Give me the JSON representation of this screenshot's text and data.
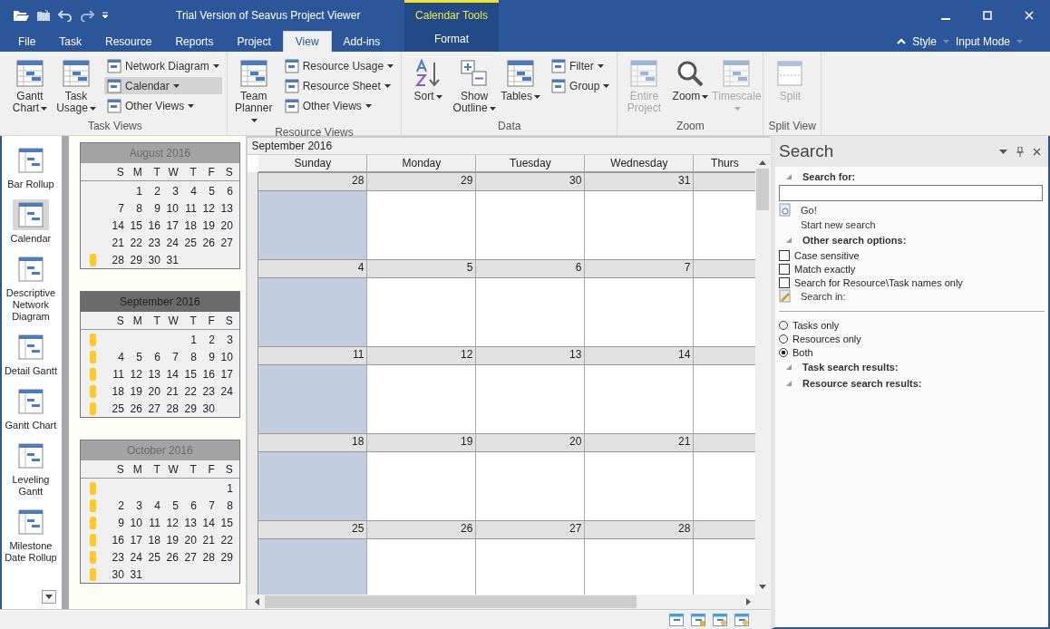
{
  "window": {
    "title": "Trial Version of Seavus Project Viewer"
  },
  "tabs": [
    {
      "label": "File",
      "selected": false
    },
    {
      "label": "Task",
      "selected": false
    },
    {
      "label": "Resource",
      "selected": false
    },
    {
      "label": "Reports",
      "selected": false
    },
    {
      "label": "Project",
      "selected": false
    },
    {
      "label": "View",
      "selected": true
    },
    {
      "label": "Add-ins",
      "selected": false
    }
  ],
  "contextual": {
    "title": "Calendar Tools",
    "tabs": [
      {
        "label": "Format",
        "selected": false
      }
    ]
  },
  "ribbon_options": [
    "Style",
    "Input Mode"
  ],
  "ribbon": {
    "groups": [
      {
        "label": "Task Views",
        "columns": [
          {
            "kind": "large",
            "label": "Gantt Chart",
            "dropdown": true,
            "disabled": false
          },
          {
            "kind": "large",
            "label": "Task Usage",
            "dropdown": true,
            "disabled": false
          },
          {
            "kind": "stack",
            "items": [
              {
                "label": "Network Diagram",
                "dropdown": true,
                "selected": false
              },
              {
                "label": "Calendar",
                "dropdown": true,
                "selected": true
              },
              {
                "label": "Other Views",
                "dropdown": true,
                "selected": false
              }
            ]
          }
        ]
      },
      {
        "label": "Resource Views",
        "columns": [
          {
            "kind": "large",
            "label": "Team Planner",
            "dropdown": true,
            "disabled": false
          },
          {
            "kind": "stack",
            "items": [
              {
                "label": "Resource Usage",
                "dropdown": true,
                "selected": false
              },
              {
                "label": "Resource Sheet",
                "dropdown": true,
                "selected": false
              },
              {
                "label": "Other Views",
                "dropdown": true,
                "selected": false
              }
            ]
          }
        ]
      },
      {
        "label": "Data",
        "columns": [
          {
            "kind": "large",
            "label": "Sort",
            "dropdown": true,
            "disabled": false
          },
          {
            "kind": "large",
            "label": "Show Outline",
            "dropdown": true,
            "disabled": false
          },
          {
            "kind": "large",
            "label": "Tables",
            "dropdown": true,
            "disabled": false
          },
          {
            "kind": "stack",
            "items": [
              {
                "label": "Filter",
                "dropdown": true,
                "selected": false
              },
              {
                "label": "Group",
                "dropdown": true,
                "selected": false
              }
            ]
          }
        ]
      },
      {
        "label": "Zoom",
        "columns": [
          {
            "kind": "large",
            "label": "Entire Project",
            "dropdown": false,
            "disabled": true
          },
          {
            "kind": "large",
            "label": "Zoom",
            "dropdown": true,
            "disabled": false
          },
          {
            "kind": "large",
            "label": "Timescale",
            "dropdown": true,
            "disabled": true
          }
        ]
      },
      {
        "label": "Split View",
        "columns": [
          {
            "kind": "large",
            "label": "Split",
            "dropdown": false,
            "disabled": true
          }
        ]
      }
    ]
  },
  "view_bar": [
    {
      "label": "Bar Rollup",
      "selected": false
    },
    {
      "label": "Calendar",
      "selected": true
    },
    {
      "label": "Descriptive Network Diagram",
      "selected": false
    },
    {
      "label": "Detail Gantt",
      "selected": false
    },
    {
      "label": "Gantt Chart",
      "selected": false
    },
    {
      "label": "Leveling Gantt",
      "selected": false
    },
    {
      "label": "Milestone Date Rollup",
      "selected": false
    }
  ],
  "mini_calendars": [
    {
      "title": "August 2016",
      "selected": false,
      "weekdays": [
        "S",
        "M",
        "T",
        "W",
        "T",
        "F",
        "S"
      ],
      "weeks": [
        {
          "marked": false,
          "days": [
            "1",
            "2",
            "3",
            "4",
            "5",
            "6"
          ]
        },
        {
          "marked": false,
          "days": [
            "7",
            "8",
            "9",
            "10",
            "11",
            "12",
            "13"
          ]
        },
        {
          "marked": false,
          "days": [
            "14",
            "15",
            "16",
            "17",
            "18",
            "19",
            "20"
          ]
        },
        {
          "marked": false,
          "days": [
            "21",
            "22",
            "23",
            "24",
            "25",
            "26",
            "27"
          ]
        },
        {
          "marked": true,
          "days": [
            "28",
            "29",
            "30",
            "31"
          ]
        }
      ]
    },
    {
      "title": "September 2016",
      "selected": true,
      "weekdays": [
        "S",
        "M",
        "T",
        "W",
        "T",
        "F",
        "S"
      ],
      "weeks": [
        {
          "marked": true,
          "days": [
            "1",
            "2",
            "3"
          ]
        },
        {
          "marked": true,
          "days": [
            "4",
            "5",
            "6",
            "7",
            "8",
            "9",
            "10"
          ]
        },
        {
          "marked": true,
          "days": [
            "11",
            "12",
            "13",
            "14",
            "15",
            "16",
            "17"
          ]
        },
        {
          "marked": true,
          "days": [
            "18",
            "19",
            "20",
            "21",
            "22",
            "23",
            "24"
          ]
        },
        {
          "marked": true,
          "days": [
            "25",
            "26",
            "27",
            "28",
            "29",
            "30"
          ]
        }
      ]
    },
    {
      "title": "October 2016",
      "selected": false,
      "weekdays": [
        "S",
        "M",
        "T",
        "W",
        "T",
        "F",
        "S"
      ],
      "weeks": [
        {
          "marked": true,
          "days": [
            "1"
          ]
        },
        {
          "marked": true,
          "days": [
            "2",
            "3",
            "4",
            "5",
            "6",
            "7",
            "8"
          ]
        },
        {
          "marked": true,
          "days": [
            "9",
            "10",
            "11",
            "12",
            "13",
            "14",
            "15"
          ]
        },
        {
          "marked": true,
          "days": [
            "16",
            "17",
            "18",
            "19",
            "20",
            "21",
            "22"
          ]
        },
        {
          "marked": true,
          "days": [
            "23",
            "24",
            "25",
            "26",
            "27",
            "28",
            "29"
          ]
        },
        {
          "marked": true,
          "days": [
            "30",
            "31"
          ]
        }
      ]
    }
  ],
  "calendar": {
    "title": "September 2016",
    "weekdays": [
      "Sunday",
      "Monday",
      "Tuesday",
      "Wednesday",
      "Thurs"
    ],
    "weeks": [
      {
        "days": [
          {
            "date": "28",
            "shaded": true
          },
          {
            "date": "29",
            "shaded": false
          },
          {
            "date": "30",
            "shaded": false
          },
          {
            "date": "31",
            "shaded": false
          }
        ]
      },
      {
        "days": [
          {
            "date": "4",
            "shaded": true
          },
          {
            "date": "5",
            "shaded": false
          },
          {
            "date": "6",
            "shaded": false
          },
          {
            "date": "7",
            "shaded": false
          }
        ]
      },
      {
        "days": [
          {
            "date": "11",
            "shaded": true
          },
          {
            "date": "12",
            "shaded": false
          },
          {
            "date": "13",
            "shaded": false
          },
          {
            "date": "14",
            "shaded": false
          }
        ]
      },
      {
        "days": [
          {
            "date": "18",
            "shaded": true
          },
          {
            "date": "19",
            "shaded": false
          },
          {
            "date": "20",
            "shaded": false
          },
          {
            "date": "21",
            "shaded": false
          }
        ]
      },
      {
        "days": [
          {
            "date": "25",
            "shaded": true
          },
          {
            "date": "26",
            "shaded": false
          },
          {
            "date": "27",
            "shaded": false
          },
          {
            "date": "28",
            "shaded": false
          }
        ]
      }
    ]
  },
  "search_pane": {
    "title": "Search",
    "search_for": {
      "heading": "Search for:",
      "expanded": true
    },
    "go_label": "Go!",
    "new_search_label": "Start new search",
    "options": {
      "heading": "Other search options:",
      "expanded": true,
      "checkboxes": [
        {
          "label": "Case sensitive",
          "checked": false
        },
        {
          "label": "Match exactly",
          "checked": false
        },
        {
          "label": "Search for Resource\\Task names only",
          "checked": false
        }
      ]
    },
    "search_in_label": "Search in:",
    "scope": [
      {
        "label": "Tasks only",
        "selected": false
      },
      {
        "label": "Resources only",
        "selected": false
      },
      {
        "label": "Both",
        "selected": true
      }
    ],
    "results": [
      {
        "heading": "Task search results:",
        "expanded": true
      },
      {
        "heading": "Resource search results:",
        "expanded": true
      }
    ]
  }
}
